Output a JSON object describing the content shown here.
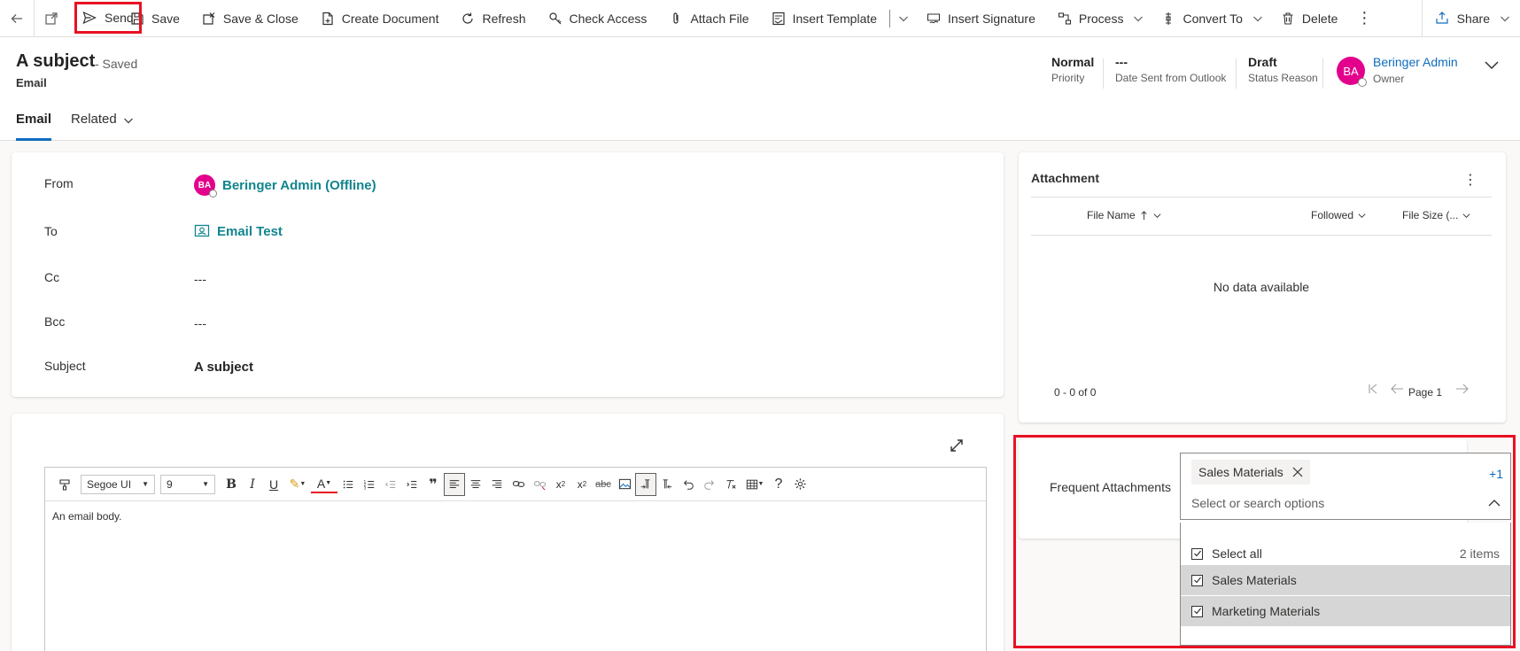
{
  "toolbar": {
    "back_icon": "back-arrow-icon",
    "popout_icon": "open-in-new-window-icon",
    "send": "Send",
    "save": "Save",
    "save_close": "Save & Close",
    "create_document": "Create Document",
    "refresh": "Refresh",
    "check_access": "Check Access",
    "attach_file": "Attach File",
    "insert_template": "Insert Template",
    "insert_signature": "Insert Signature",
    "process": "Process",
    "convert_to": "Convert To",
    "delete": "Delete",
    "more": "⋮",
    "share": "Share"
  },
  "header": {
    "title": "A subject",
    "saved_status": "- Saved",
    "entity": "Email",
    "priority_value": "Normal",
    "priority_label": "Priority",
    "date_sent_value": "---",
    "date_sent_label": "Date Sent from Outlook",
    "status_value": "Draft",
    "status_label": "Status Reason",
    "owner_initials": "BA",
    "owner_name": "Beringer Admin",
    "owner_label": "Owner",
    "tabs": [
      "Email",
      "Related"
    ]
  },
  "form": {
    "from_label": "From",
    "from_initials": "BA",
    "from_value": "Beringer Admin (Offline)",
    "to_label": "To",
    "to_value": "Email Test",
    "cc_label": "Cc",
    "cc_value": "---",
    "bcc_label": "Bcc",
    "bcc_value": "---",
    "subject_label": "Subject",
    "subject_value": "A subject"
  },
  "editor": {
    "font_family": "Segoe UI",
    "font_size": "9",
    "body": "An email body."
  },
  "attachments": {
    "title": "Attachment",
    "more": "⋮",
    "columns": [
      "File Name",
      "Followed",
      "File Size (..."
    ],
    "empty_text": "No data available",
    "range": "0 - 0 of 0",
    "page_label": "Page 1"
  },
  "frequent": {
    "label": "Frequent Attachments",
    "tag": "Sales Materials",
    "more_count": "+1",
    "placeholder": "Select or search options",
    "select_all": "Select all",
    "count": "2 items",
    "options": [
      "Sales Materials",
      "Marketing Materials"
    ]
  },
  "colors": {
    "accent": "#0f6cbd",
    "link_teal": "#11858e",
    "avatar": "#e3008c",
    "highlight": "#e81123"
  }
}
